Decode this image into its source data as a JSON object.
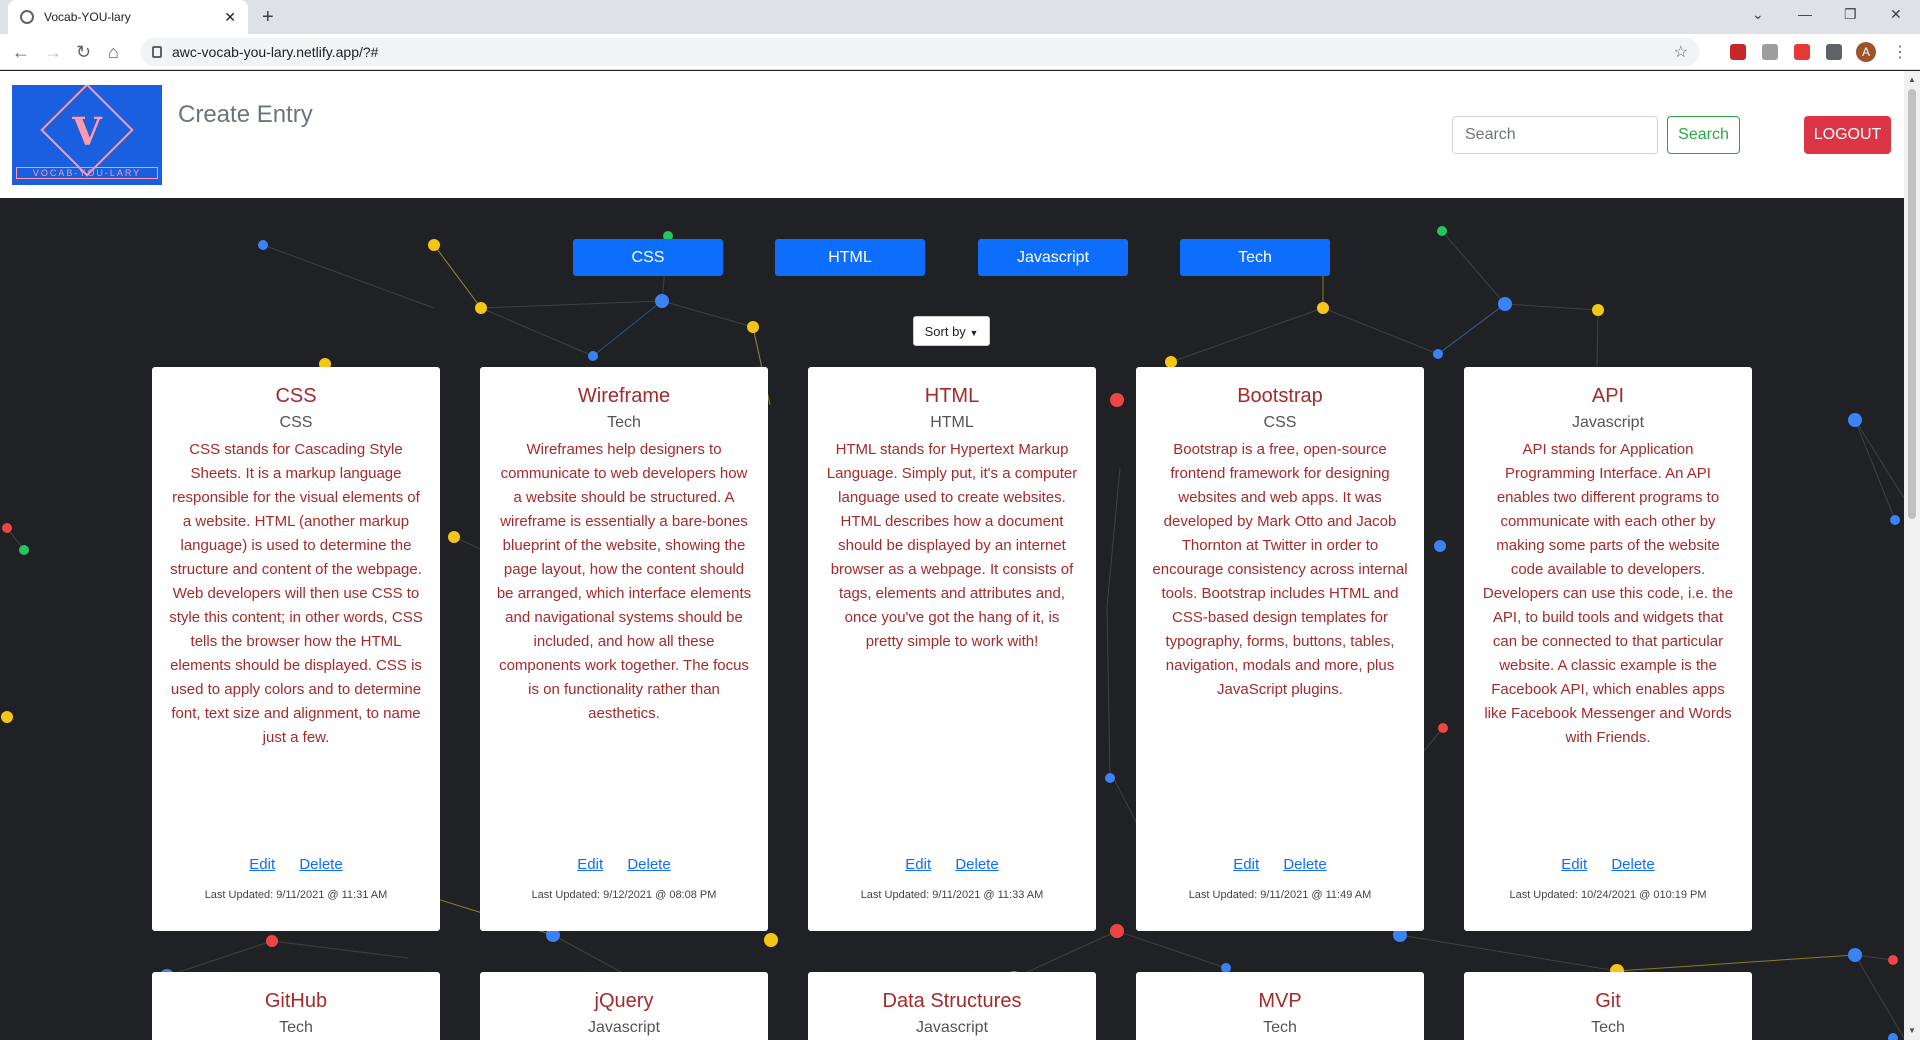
{
  "browser": {
    "tab_title": "Vocab-YOU-lary",
    "url": "awc-vocab-you-lary.netlify.app/?#",
    "profile_initial": "A"
  },
  "header": {
    "logo_letter": "V",
    "logo_tagline": "VOCAB-YOU-LARY",
    "create_entry": "Create Entry",
    "search_placeholder": "Search",
    "search_button": "Search",
    "logout_button": "LOGOUT"
  },
  "categories": [
    "CSS",
    "HTML",
    "Javascript",
    "Tech"
  ],
  "sort_label": "Sort by",
  "card_actions": {
    "edit": "Edit",
    "delete": "Delete"
  },
  "cards": [
    {
      "title": "CSS",
      "category": "CSS",
      "description": "CSS stands for Cascading Style Sheets. It is a markup language responsible for the visual elements of a website. HTML (another markup language) is used to determine the structure and content of the webpage. Web developers will then use CSS to style this content; in other words, CSS tells the browser how the HTML elements should be displayed. CSS is used to apply colors and to determine font, text size and alignment, to name just a few.",
      "updated": "Last Updated: 9/11/2021 @ 11:31 AM"
    },
    {
      "title": "Wireframe",
      "category": "Tech",
      "description": "Wireframes help designers to communicate to web developers how a website should be structured. A wireframe is essentially a bare-bones blueprint of the website, showing the page layout, how the content should be arranged, which interface elements and navigational systems should be included, and how all these components work together. The focus is on functionality rather than aesthetics.",
      "updated": "Last Updated: 9/12/2021 @ 08:08 PM"
    },
    {
      "title": "HTML",
      "category": "HTML",
      "description": "HTML stands for Hypertext Markup Language. Simply put, it's a computer language used to create websites. HTML describes how a document should be displayed by an internet browser as a webpage. It consists of tags, elements and attributes and, once you've got the hang of it, is pretty simple to work with!",
      "updated": "Last Updated: 9/11/2021 @ 11:33 AM"
    },
    {
      "title": "Bootstrap",
      "category": "CSS",
      "description": "Bootstrap is a free, open-source frontend framework for designing websites and web apps. It was developed by Mark Otto and Jacob Thornton at Twitter in order to encourage consistency across internal tools. Bootstrap includes HTML and CSS-based design templates for typography, forms, buttons, tables, navigation, modals and more, plus JavaScript plugins.",
      "updated": "Last Updated: 9/11/2021 @ 11:49 AM"
    },
    {
      "title": "API",
      "category": "Javascript",
      "description": "API stands for Application Programming Interface. An API enables two different programs to communicate with each other by making some parts of the website code available to developers. Developers can use this code, i.e. the API, to build tools and widgets that can be connected to that particular website. A classic example is the Facebook API, which enables apps like Facebook Messenger and Words with Friends.",
      "updated": "Last Updated: 10/24/2021 @ 010:19 PM"
    },
    {
      "title": "GitHub",
      "category": "Tech"
    },
    {
      "title": "jQuery",
      "category": "Javascript"
    },
    {
      "title": "Data Structures",
      "category": "Javascript"
    },
    {
      "title": "MVP",
      "category": "Tech"
    },
    {
      "title": "Git",
      "category": "Tech"
    }
  ],
  "colors": {
    "primary": "#0d6efd",
    "danger": "#dc3545",
    "success": "#28a745",
    "card_text": "#a52a2a",
    "background": "#202124"
  }
}
